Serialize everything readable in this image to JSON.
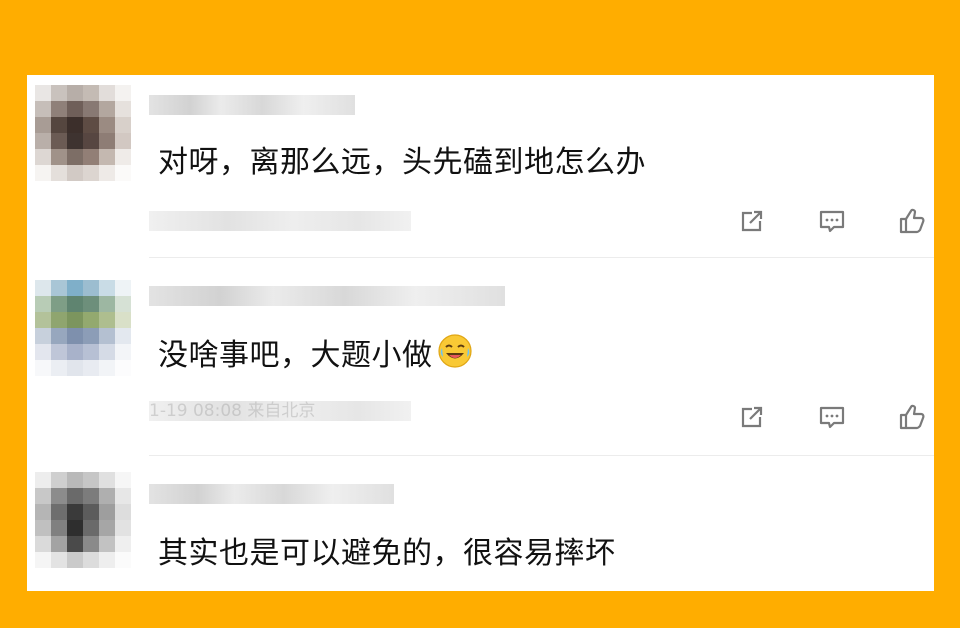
{
  "comments": [
    {
      "text": "对呀，离那么远，头先磕到地怎么办",
      "meta": "",
      "emoji": ""
    },
    {
      "text": "没啥事吧，大题小做",
      "meta": "1-19 08:08 来自北京",
      "emoji": "laughing-crying-emoji"
    },
    {
      "text": "其实也是可以避免的，很容易摔坏",
      "meta": "",
      "emoji": ""
    }
  ],
  "icons": {
    "share": "share-icon",
    "comment": "comment-icon",
    "like": "thumbs-up-icon"
  },
  "colors": {
    "frame": "#FFAD00",
    "card": "#FFFFFF",
    "text": "#111111",
    "icon": "#7A7A7A"
  }
}
